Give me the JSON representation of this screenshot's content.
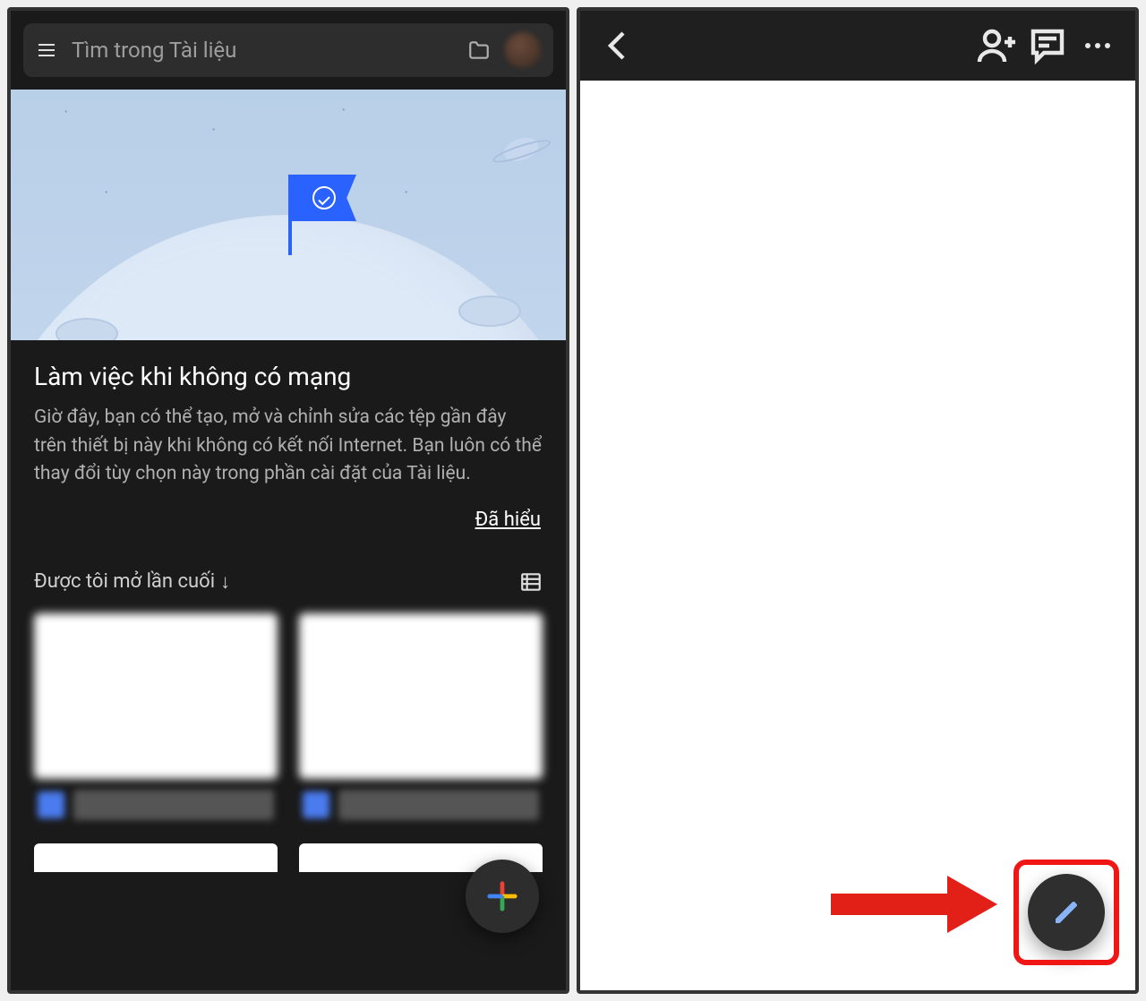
{
  "left": {
    "search": {
      "placeholder": "Tìm trong Tài liệu"
    },
    "card": {
      "title": "Làm việc khi không có mạng",
      "body": "Giờ đây, bạn có thể tạo, mở và chỉnh sửa các tệp gần đây trên thiết bị này khi không có kết nối Internet. Bạn luôn có thể thay đổi tùy chọn này trong phần cài đặt của Tài liệu.",
      "action": "Đã hiểu"
    },
    "sort": {
      "label": "Được tôi mở lần cuối",
      "arrow": "↓"
    },
    "docs": [
      {
        "title": "Tài liệu"
      },
      {
        "title": "Tài liệu"
      }
    ],
    "fab": {
      "icon": "plus",
      "colors": {
        "r": "#ea4335",
        "y": "#fbbc05",
        "g": "#34a853",
        "b": "#4285f4"
      }
    }
  },
  "right": {
    "appbar": {
      "back": "back",
      "share": "person-add",
      "comment": "comment",
      "menu": "more"
    },
    "fab": {
      "icon": "pencil",
      "color": "#8ab4f8"
    }
  },
  "annotation": {
    "arrow_color": "#f11616"
  }
}
